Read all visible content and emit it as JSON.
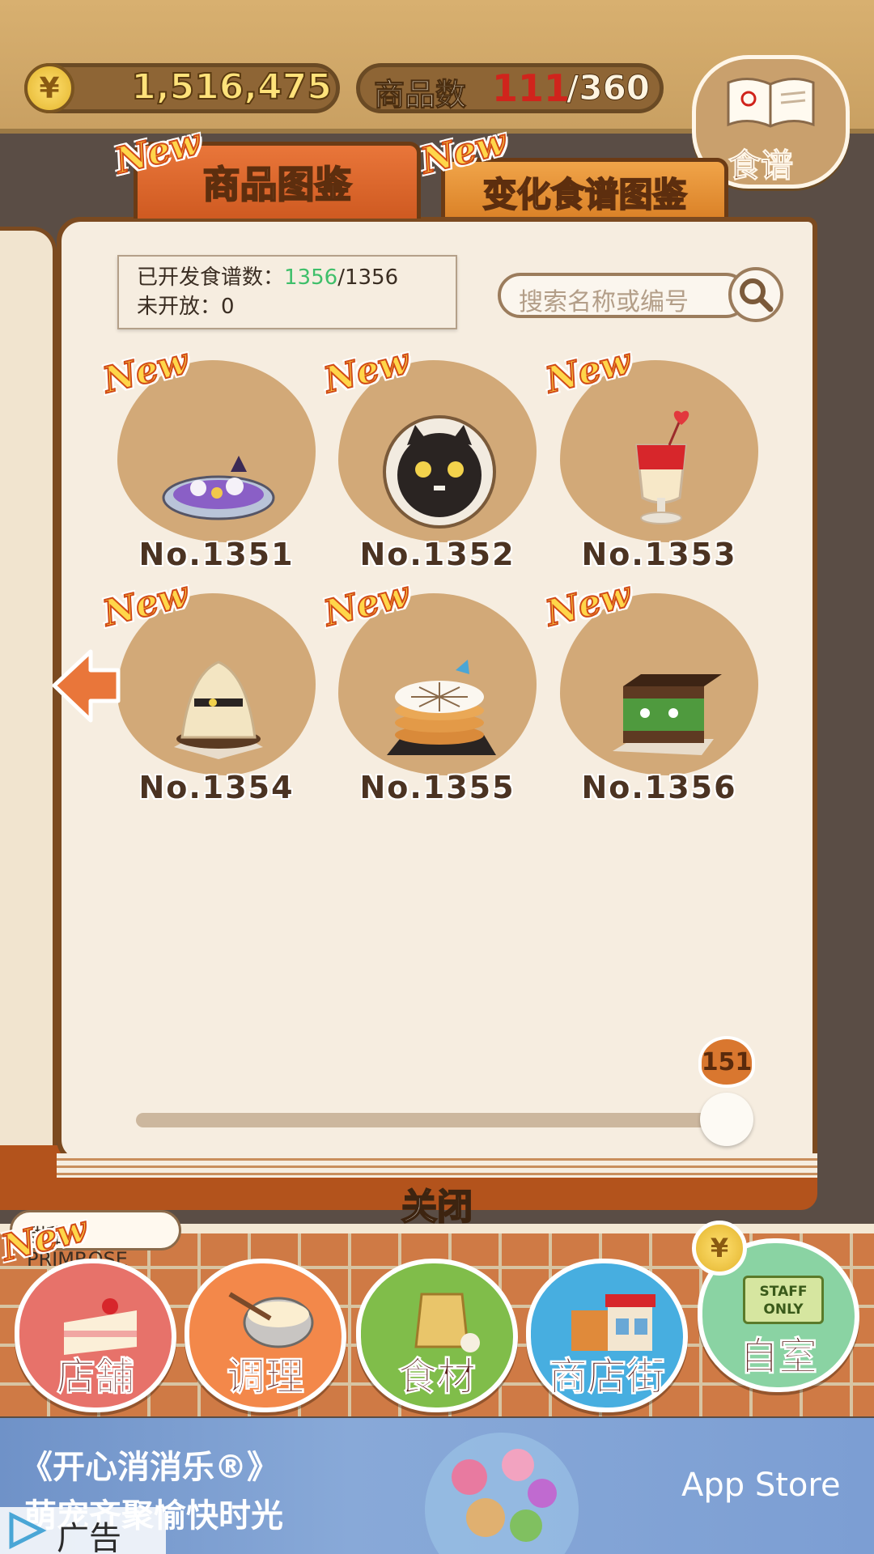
{
  "header": {
    "coin_symbol": "¥",
    "coins": "1,516,475",
    "goods_label": "商品数",
    "goods_current": "111",
    "goods_total": "/360",
    "recipe_button_label": "食谱"
  },
  "tabs": [
    {
      "label": "商品图鉴",
      "new": "New",
      "active": true
    },
    {
      "label": "变化食谱图鉴",
      "new": "New",
      "active": false
    }
  ],
  "info": {
    "opened_label": "已开发食谱数：",
    "opened_value": "1356",
    "opened_total": "/1356",
    "closed_label": "未开放：0"
  },
  "search": {
    "placeholder": "搜索名称或编号"
  },
  "items": [
    {
      "number": "No.1351",
      "new": "New",
      "food": "purple-halloween-dish"
    },
    {
      "number": "No.1352",
      "new": "New",
      "food": "black-cat-plate"
    },
    {
      "number": "No.1353",
      "new": "New",
      "food": "red-parfait"
    },
    {
      "number": "No.1354",
      "new": "New",
      "food": "mummy-mont-blanc"
    },
    {
      "number": "No.1355",
      "new": "New",
      "food": "spider-web-pancakes"
    },
    {
      "number": "No.1356",
      "new": "New",
      "food": "green-monster-cake"
    }
  ],
  "slider": {
    "value": "151",
    "fraction": 0.98
  },
  "close_label": "关闭",
  "shop_name": "甜甜 · PRIMROSE",
  "nav": {
    "new": "New",
    "store": "店舗",
    "cook": "调理",
    "ingredients": "食材",
    "street": "商店街",
    "room": "自室",
    "room_coin": "¥",
    "staff_sign": "STAFF ONLY"
  },
  "ad": {
    "title": "《开心消消乐®》",
    "subtitle": "萌宠齐聚愉快时光",
    "store": " App Store",
    "label": "广告"
  },
  "colors": {
    "accent": "#e9763a",
    "highlight_green": "#3fbf6a",
    "red_count": "#d0241c"
  }
}
